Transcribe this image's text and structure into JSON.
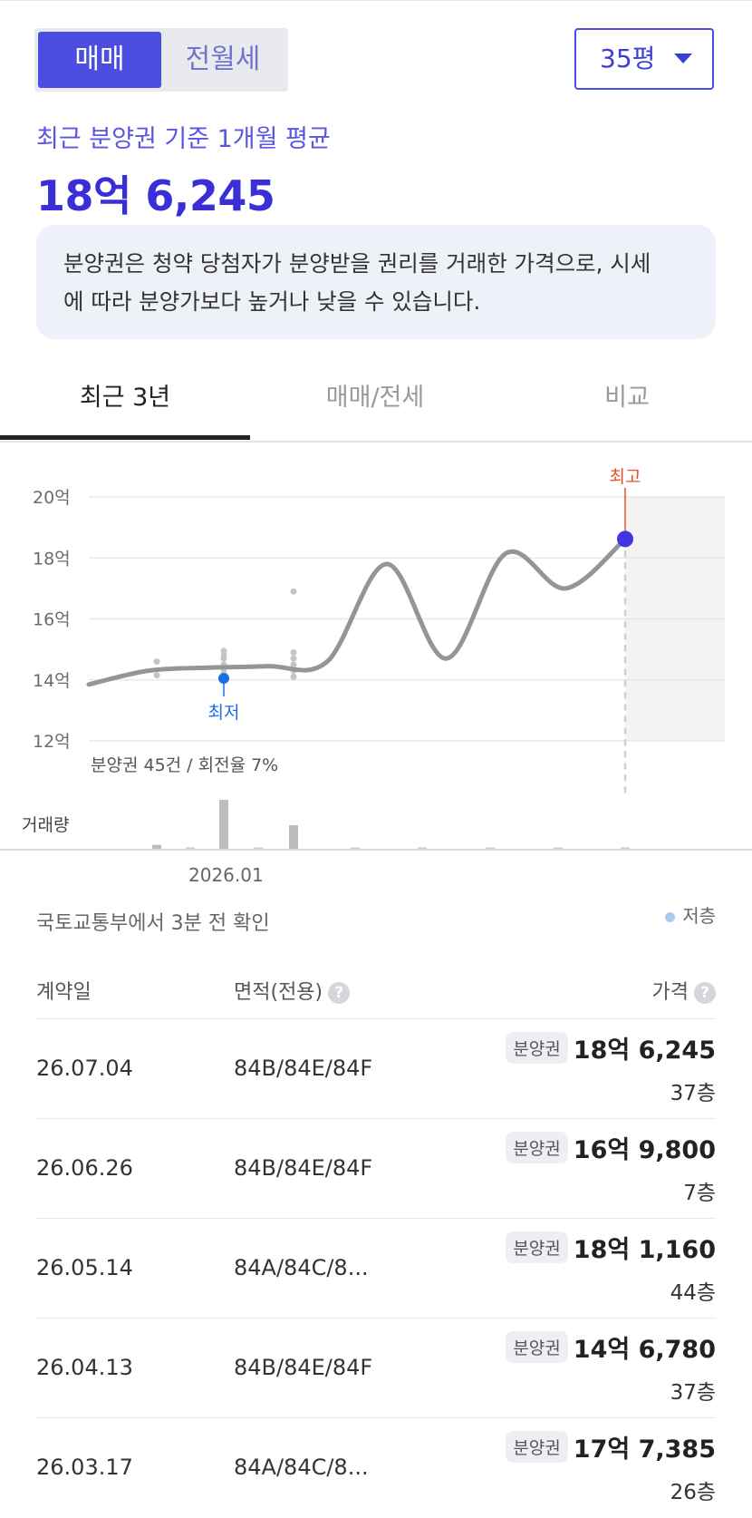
{
  "toggle": {
    "active": "매매",
    "inactive": "전월세"
  },
  "size_select": {
    "value": "35평"
  },
  "summary": {
    "label": "최근 분양권 기준 1개월 평균",
    "price": "18억 6,245",
    "notice_line1": "분양권은 청약 당첨자가 분양받을 권리를 거래한 가격으로, 시세",
    "notice_line2": "에 따라 분양가보다 높거나 낮을 수 있습니다."
  },
  "tabs": [
    "최근 3년",
    "매매/전세",
    "비교"
  ],
  "chart_data": {
    "type": "line",
    "y_unit": "억",
    "ylim": [
      12,
      20
    ],
    "yticks": [
      "20억",
      "18억",
      "16억",
      "14억",
      "12억"
    ],
    "x_tick_labels": [
      "2026.01"
    ],
    "series": [
      {
        "values": [
          13.85,
          14.3,
          14.4,
          14.45,
          14.6,
          17.8,
          14.7,
          18.15,
          17.0,
          18.62
        ]
      }
    ],
    "scatter_points": [
      14.6,
      14.15,
      14.95,
      14.8,
      14.7,
      14.5,
      14.35,
      14.2,
      16.9,
      14.9,
      14.7,
      14.5,
      14.3,
      14.1
    ],
    "lowest": {
      "label": "최저",
      "value": 14.05
    },
    "highest": {
      "label": "최고",
      "value": 18.62
    },
    "stats_text": "분양권 45건 / 회전율 7%",
    "volume_label": "거래량",
    "volume": [
      2,
      0,
      25,
      0,
      12,
      0,
      0,
      0,
      0,
      0
    ],
    "grid": true,
    "colors": {
      "line": "#959595",
      "high": "#4035e0",
      "high_label": "#e8521e",
      "low": "#1b6ee8",
      "shade": "#f3f3f3"
    }
  },
  "source_text": "국토교통부에서 3분 전 확인",
  "legend": {
    "label": "저층",
    "color": "#a9cdf0"
  },
  "table": {
    "headers": {
      "date": "계약일",
      "area": "면적(전용)",
      "price": "가격",
      "help": "?"
    },
    "rows": [
      {
        "date": "26.07.04",
        "area": "84B/84E/84F",
        "badge": "분양권",
        "price": "18억 6,245",
        "floor": "37층"
      },
      {
        "date": "26.06.26",
        "area": "84B/84E/84F",
        "badge": "분양권",
        "price": "16억 9,800",
        "floor": "7층"
      },
      {
        "date": "26.05.14",
        "area": "84A/84C/8...",
        "badge": "분양권",
        "price": "18억 1,160",
        "floor": "44층"
      },
      {
        "date": "26.04.13",
        "area": "84B/84E/84F",
        "badge": "분양권",
        "price": "14억 6,780",
        "floor": "37층"
      },
      {
        "date": "26.03.17",
        "area": "84A/84C/8...",
        "badge": "분양권",
        "price": "17억 7,385",
        "floor": "26층"
      }
    ]
  }
}
